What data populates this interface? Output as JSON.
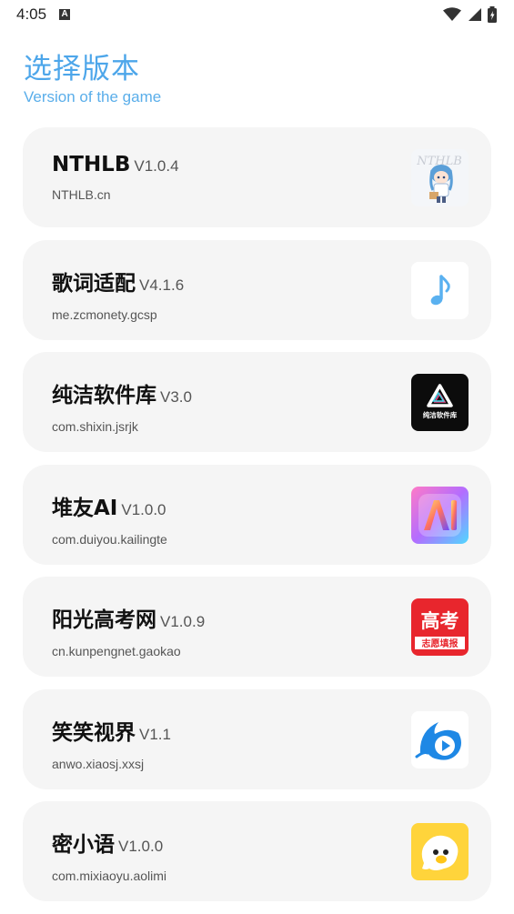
{
  "status": {
    "time": "4:05",
    "notification_letter": "A"
  },
  "header": {
    "title": "选择版本",
    "subtitle": "Version of the game"
  },
  "versions": [
    {
      "name": "NTHLB",
      "version": "V1.0.4",
      "package": "NTHLB.cn",
      "icon": "nthlb-anime-character-icon",
      "icon_text": "NTHLB"
    },
    {
      "name": "歌词适配",
      "version": "V4.1.6",
      "package": "me.zcmonety.gcsp",
      "icon": "music-note-icon"
    },
    {
      "name": "纯洁软件库",
      "version": "V3.0",
      "package": "com.shixin.jsrjk",
      "icon": "chunjie-software-library-icon",
      "icon_text": "纯洁软件库"
    },
    {
      "name": "堆友AI",
      "version": "V1.0.0",
      "package": "com.duiyou.kailingte",
      "icon": "duiyou-ai-icon"
    },
    {
      "name": "阳光高考网",
      "version": "V1.0.9",
      "package": "cn.kunpengnet.gaokao",
      "icon": "gaokao-icon",
      "icon_text": "高考",
      "icon_subtext": "志愿填报"
    },
    {
      "name": "笑笑视界",
      "version": "V1.1",
      "package": "anwo.xiaosj.xxsj",
      "icon": "play-dolphin-icon"
    },
    {
      "name": "密小语",
      "version": "V1.0.0",
      "package": "com.mixiaoyu.aolimi",
      "icon": "yellow-ghost-mascot-icon"
    }
  ],
  "colors": {
    "accent": "#4da6ea",
    "card_bg": "#f5f5f5"
  }
}
